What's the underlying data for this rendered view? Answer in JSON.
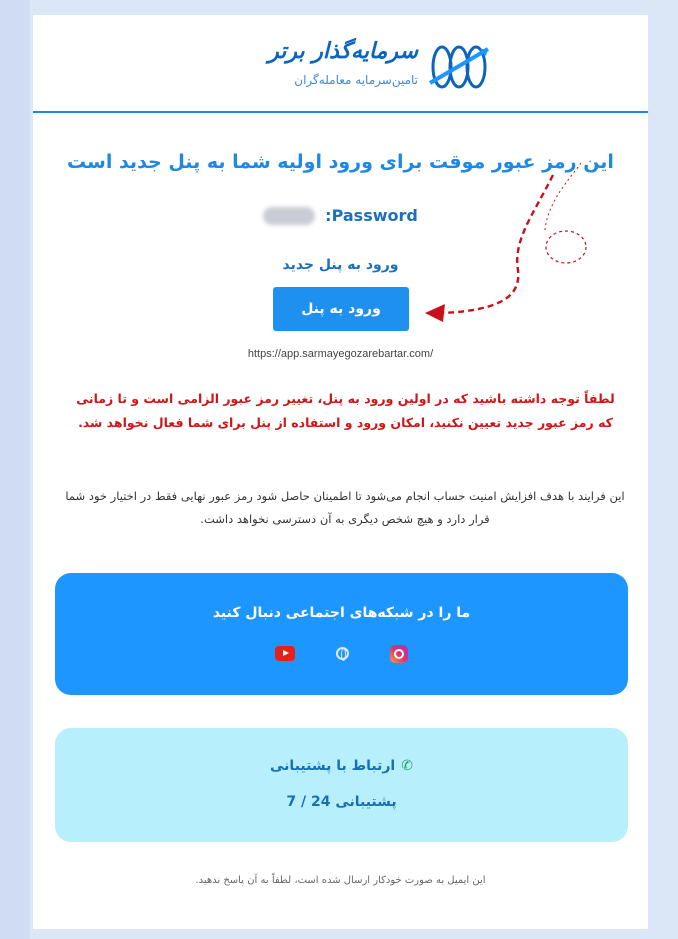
{
  "brand": {
    "name": "سرمایه‌گذار برتر",
    "tagline": "تامین‌سرمایه معامله‌گران",
    "colors": {
      "primary": "#1e88e5",
      "warning": "#d01515",
      "social_bg": "#1e96ff",
      "support_bg": "#b7f0fc"
    }
  },
  "email": {
    "title": "این رمز عبور موقت برای ورود اولیه شما به پنل جدید است",
    "password_label": ":Password",
    "panel_link_text": "ورود به پنل جدید",
    "login_button": "ورود به پنل",
    "url": "https://app.sarmayegozarebartar.com/",
    "warning": "لطفاً توجه داشته باشید که در اولین ورود به پنل، تغییر رمز عبور الزامی است و تا زمانی که رمز عبور جدید تعیین نکنید، امکان ورود و استفاده از پنل برای شما فعال نخواهد شد.",
    "info": "این فرایند با هدف افزایش امنیت حساب انجام می‌شود تا اطمینان حاصل شود رمز عبور نهایی فقط در اختیار خود شما قرار دارد و هیچ شخص دیگری به آن دسترسی نخواهد داشت."
  },
  "social": {
    "title": "ما را در شبکه‌های اجتماعی دنبال کنید",
    "icons": [
      "youtube-icon",
      "globe-icon",
      "instagram-icon"
    ]
  },
  "support": {
    "title": "ارتباط با پشتیبانی",
    "hours": "پشتیبانی 24 / 7",
    "icon": "phone-icon"
  },
  "footer": "این ایمیل به صورت خودکار ارسال شده است، لطفاً به آن پاسخ ندهید."
}
